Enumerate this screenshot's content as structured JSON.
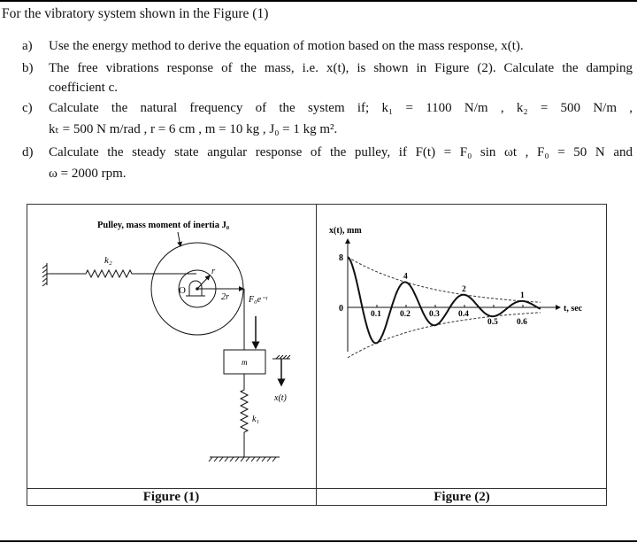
{
  "intro": "For the vibratory system shown in the Figure (1)",
  "items": [
    {
      "label": "a)",
      "lines": [
        "Use the energy method to derive the equation of motion based on the mass response, x(t)."
      ]
    },
    {
      "label": "b)",
      "lines": [
        "The free vibrations response of the mass, i.e. x(t), is shown in Figure (2). Calculate the damping",
        "coefficient c."
      ]
    },
    {
      "label": "c)",
      "lines": [
        "Calculate the natural frequency of the system if; k₁ = 1100 N/m , k₂ = 500 N/m ,",
        "kₜ = 500 N m/rad , r = 6 cm , m = 10 kg , J₀ = 1 kg m²."
      ]
    },
    {
      "label": "d)",
      "lines": [
        "Calculate the steady state angular response of the pulley, if F(t) = F₀ sin ωt , F₀ = 50 N and",
        "ω = 2000 rpm."
      ]
    }
  ],
  "figure1": {
    "caption": "Figure (1)",
    "pulley_label": "Pulley, mass moment of inertia J₀",
    "k2": "k₂",
    "k1": "k₁",
    "r": "r",
    "two_r": "2r",
    "O": "O",
    "force": "F₀e⁻ᵗ",
    "mass": "m",
    "displacement": "x(t)"
  },
  "figure2": {
    "caption": "Figure (2)",
    "chart_data": {
      "type": "line",
      "ylabel": "x(t), mm",
      "xlabel": "t, sec",
      "y_tick_labels": [
        "8",
        "0"
      ],
      "x_tick_labels": [
        "0.1",
        "0.2",
        "0.3",
        "0.4",
        "0.5",
        "0.6"
      ],
      "peak_labels": [
        {
          "t": 0,
          "x": 8,
          "label": "8"
        },
        {
          "t": 0.2,
          "x": 4,
          "label": "4"
        },
        {
          "t": 0.4,
          "x": 2,
          "label": "2"
        },
        {
          "t": 0.6,
          "x": 1,
          "label": "1"
        }
      ],
      "period": 0.2,
      "initial_amplitude": 8,
      "decay_ratio_per_period": 0.5,
      "envelope": "dashed",
      "xlim": [
        0,
        0.66
      ]
    }
  }
}
